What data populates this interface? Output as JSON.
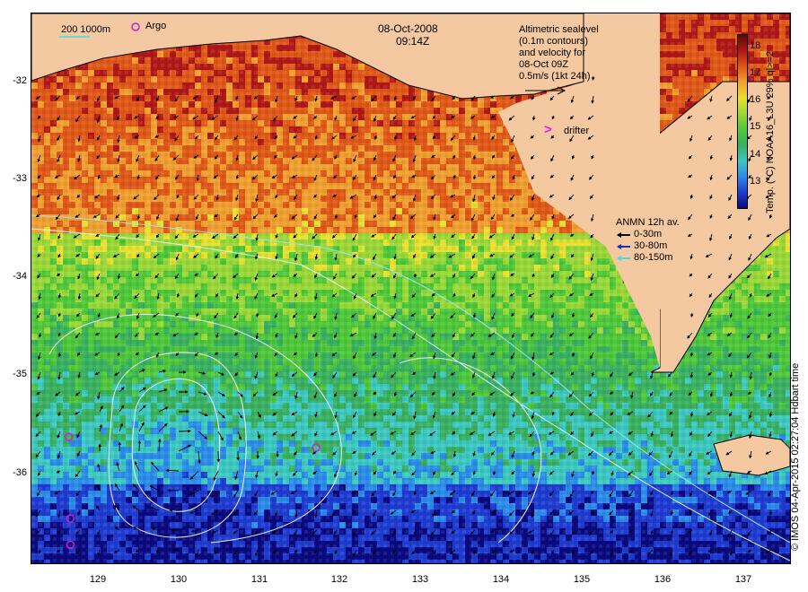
{
  "map": {
    "y_ticks": [
      "-32",
      "-33",
      "-34",
      "-35",
      "-36"
    ],
    "x_ticks": [
      "129",
      "130",
      "131",
      "132",
      "133",
      "134",
      "135",
      "136",
      "137"
    ],
    "x_range": [
      128.15,
      137.5
    ],
    "y_range": [
      -36.92,
      -31.27
    ]
  },
  "header": {
    "date": "08-Oct-2008",
    "time": "09:14Z"
  },
  "legend": {
    "isobath_label": "200  1000m",
    "argo_label": "Argo",
    "drifter_label": "drifter",
    "altimetry_lines": [
      "Altimetric sealevel",
      "(0.1m contours)",
      "and velocity for",
      "08-Oct 09Z",
      "0.5m/s (1kt 24h)"
    ],
    "anmn_title": "ANMN 12h av.",
    "anmn_items": [
      {
        "label": "0-30m",
        "color": "#000000"
      },
      {
        "label": "30-80m",
        "color": "#1030c0"
      },
      {
        "label": "80-150m",
        "color": "#40e0e0"
      }
    ]
  },
  "colorbar": {
    "title": "Temp. (°C) NOAA16_L3U 29% ql>=2",
    "ticks": [
      "18",
      "17",
      "16",
      "15",
      "14",
      "13"
    ],
    "range": [
      12.2,
      18.6
    ],
    "colors": [
      "#0a0a80",
      "#1e3cd0",
      "#2a8ce8",
      "#3cc8c0",
      "#38b060",
      "#4ec83a",
      "#9ad838",
      "#e8e030",
      "#f0a030",
      "#e05818",
      "#b01818",
      "#5a0a0a"
    ]
  },
  "credit": "© IMOS 04-Apr-2015 02:27:04 Hdbart time",
  "argo_floats": [
    {
      "lon": 129.48,
      "lat": -31.46
    },
    {
      "lon": 128.61,
      "lat": -35.62
    },
    {
      "lon": 131.66,
      "lat": -35.73
    },
    {
      "lon": 128.63,
      "lat": -36.46
    },
    {
      "lon": 128.63,
      "lat": -36.73
    }
  ],
  "colors": {
    "land": "#f4c8a0",
    "argo": "#d020d0",
    "drifter": "#e020e0",
    "isobath_200": "#a0e0f0",
    "isobath_1000": "#e0f8f0",
    "contour": "#f0f0f0"
  }
}
